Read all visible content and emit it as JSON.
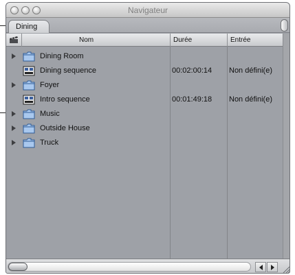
{
  "window": {
    "title": "Navigateur"
  },
  "tabs": [
    {
      "label": "Dining"
    }
  ],
  "columns": {
    "name": "Nom",
    "duration": "Durée",
    "entry": "Entrée"
  },
  "rows": [
    {
      "kind": "bin",
      "name": "Dining Room",
      "duration": "",
      "entry": ""
    },
    {
      "kind": "sequence",
      "name": "Dining sequence",
      "duration": "00:02:00:14",
      "entry": "Non défini(e)"
    },
    {
      "kind": "bin",
      "name": "Foyer",
      "duration": "",
      "entry": ""
    },
    {
      "kind": "sequence",
      "name": "Intro sequence",
      "duration": "00:01:49:18",
      "entry": "Non défini(e)"
    },
    {
      "kind": "bin",
      "name": "Music",
      "duration": "",
      "entry": ""
    },
    {
      "kind": "bin",
      "name": "Outside House",
      "duration": "",
      "entry": ""
    },
    {
      "kind": "bin",
      "name": "Truck",
      "duration": "",
      "entry": ""
    }
  ],
  "icons": {
    "bin": "folder-icon",
    "sequence": "sequence-icon",
    "expand": "disclosure-triangle-icon",
    "header": "clapper-icon"
  },
  "colors": {
    "list_background": "#9ea1a7",
    "folder_fill": "#a9c8ee",
    "folder_stroke": "#2f5b96"
  }
}
